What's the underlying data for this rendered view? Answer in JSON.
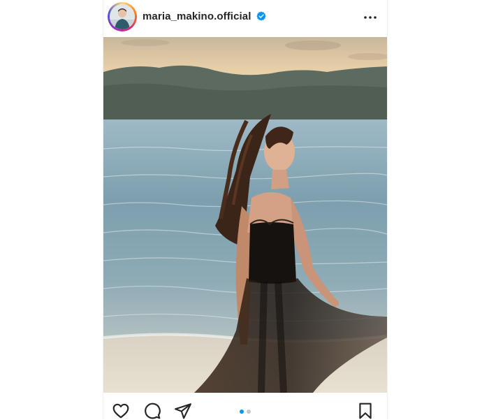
{
  "post": {
    "username": "maria_makino.official",
    "verified": true,
    "accent_color": "#0095f6",
    "carousel": {
      "total": 2,
      "current": 1
    },
    "actions": [
      "heart-icon",
      "comment-icon",
      "share-icon",
      "bookmark-icon"
    ],
    "header_menu_icon": "more-icon"
  }
}
